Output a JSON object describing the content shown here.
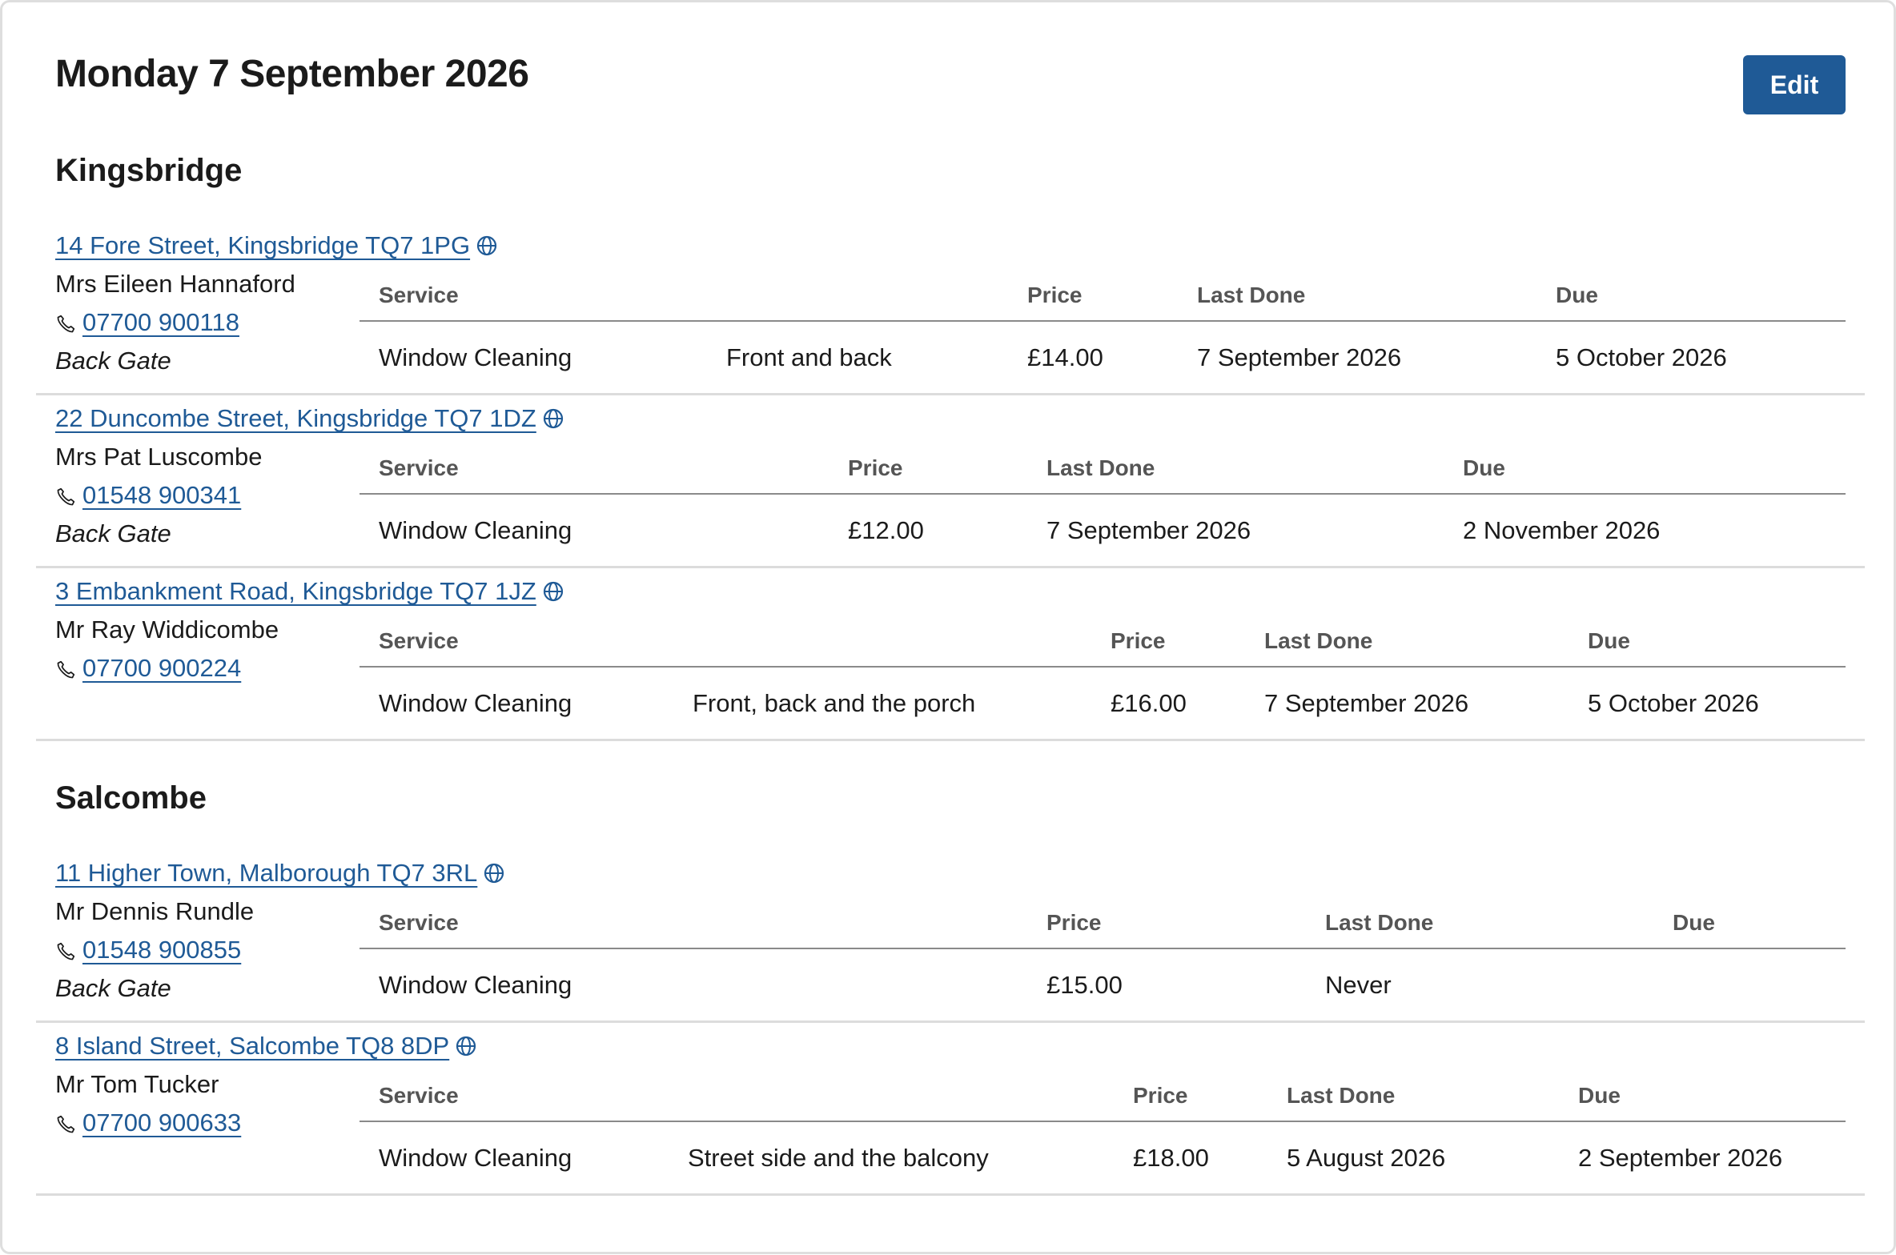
{
  "header": {
    "title": "Monday 7 September 2026",
    "edit_label": "Edit"
  },
  "table_headers": {
    "service": "Service",
    "price": "Price",
    "last_done": "Last Done",
    "due": "Due"
  },
  "areas": [
    {
      "name": "Kingsbridge",
      "properties": [
        {
          "address": "14 Fore Street, Kingsbridge TQ7 1PG",
          "customer": "Mrs Eileen Hannaford",
          "phone": "07700 900118",
          "note": "Back Gate",
          "service": "Window Cleaning",
          "description": "Front and back",
          "price": "£14.00",
          "last_done": "7 September 2026",
          "due": "5 October 2026"
        },
        {
          "address": "22 Duncombe Street, Kingsbridge TQ7 1DZ",
          "customer": "Mrs Pat Luscombe",
          "phone": "01548 900341",
          "note": "Back Gate",
          "service": "Window Cleaning",
          "description": "",
          "price": "£12.00",
          "last_done": "7 September 2026",
          "due": "2 November 2026"
        },
        {
          "address": "3 Embankment Road, Kingsbridge TQ7 1JZ",
          "customer": "Mr Ray Widdicombe",
          "phone": "07700 900224",
          "note": "",
          "service": "Window Cleaning",
          "description": "Front, back and the porch",
          "price": "£16.00",
          "last_done": "7 September 2026",
          "due": "5 October 2026"
        }
      ]
    },
    {
      "name": "Salcombe",
      "properties": [
        {
          "address": "11 Higher Town, Malborough TQ7 3RL",
          "customer": "Mr Dennis Rundle",
          "phone": "01548 900855",
          "note": "Back Gate",
          "service": "Window Cleaning",
          "description": "",
          "price": "£15.00",
          "last_done": "Never",
          "due": ""
        },
        {
          "address": "8 Island Street, Salcombe TQ8 8DP",
          "customer": "Mr Tom Tucker",
          "phone": "07700 900633",
          "note": "",
          "service": "Window Cleaning",
          "description": "Street side and the balcony",
          "price": "£18.00",
          "last_done": "5 August 2026",
          "due": "2 September 2026"
        }
      ]
    }
  ],
  "icons": {
    "address": "globe-icon",
    "phone": "phone-icon"
  },
  "colors": {
    "link": "#1f5a96",
    "button": "#1f5a96"
  }
}
